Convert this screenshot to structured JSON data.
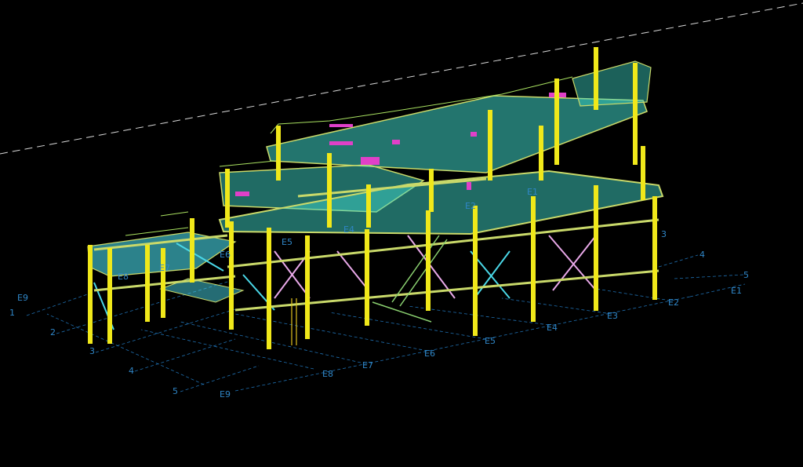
{
  "view": {
    "background": "#000000",
    "grid_line_color": "#1f6fb0",
    "reference_line_color": "#d8d8d8"
  },
  "colors": {
    "columns": "#f0e81a",
    "beams": "#c9d96a",
    "grating": "#3fd6c8",
    "bracing_cyan": "#4ad8e8",
    "bracing_pink": "#e8a8e8",
    "equipment_magenta": "#e040c8",
    "handrail": "#a8e060",
    "stair": "#8ad070"
  },
  "grid": {
    "numbered_axes_left": [
      "1",
      "2",
      "3",
      "4",
      "5"
    ],
    "numbered_axes_right": [
      "4",
      "5"
    ],
    "lettered_axes_bottom": [
      "E9",
      "E8",
      "E7",
      "E6",
      "E5",
      "E4",
      "E3",
      "E2",
      "E1"
    ],
    "lettered_axes_left": [
      "E9"
    ],
    "lettered_axes_in_model": [
      "E1",
      "E2",
      "E4",
      "E5",
      "E6",
      "E7",
      "E8"
    ],
    "right_edge_marker": "3"
  }
}
